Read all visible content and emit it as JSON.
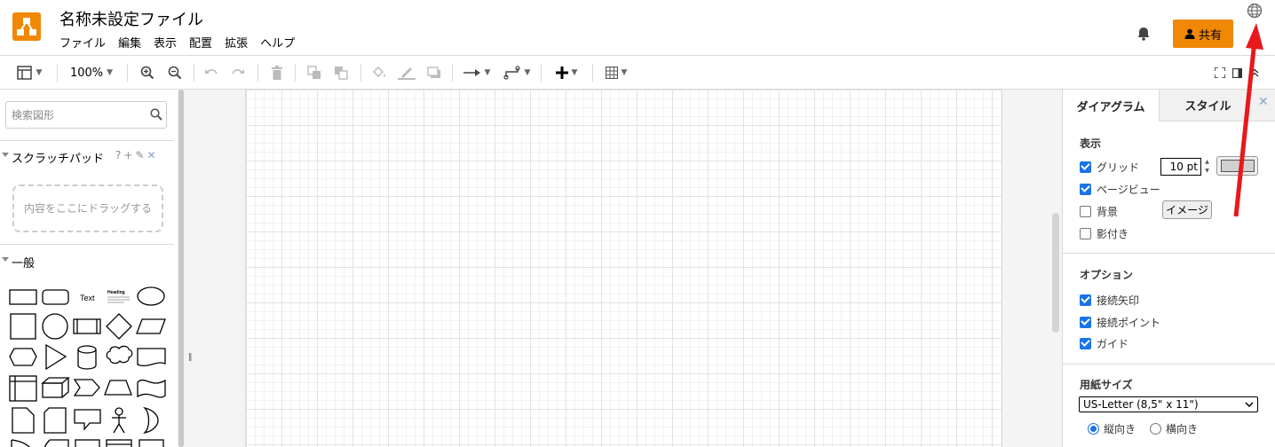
{
  "app": {
    "title": "名称未設定ファイル",
    "menu": [
      "ファイル",
      "編集",
      "表示",
      "配置",
      "拡張",
      "ヘルプ"
    ],
    "share_label": "共有",
    "brand_color": "#f08705"
  },
  "toolbar": {
    "zoom": "100%"
  },
  "sidebar": {
    "search_placeholder": "検索図形",
    "scratchpad_title": "スクラッチパッド",
    "scratchpad_tools": [
      "?",
      "+",
      "✎",
      "✕"
    ],
    "dropzone_text": "内容をここにドラッグする",
    "general_title": "一般",
    "shape_text": "Text",
    "shape_heading": "Heading"
  },
  "panel": {
    "tab_diagram": "ダイアグラム",
    "tab_style": "スタイル",
    "view_title": "表示",
    "grid_label": "グリッド",
    "grid_checked": true,
    "grid_size": "10 pt",
    "pageview_label": "ページビュー",
    "pageview_checked": true,
    "background_label": "背景",
    "background_checked": false,
    "image_button": "イメージ",
    "shadow_label": "影付き",
    "shadow_checked": false,
    "options_title": "オプション",
    "connection_arrows_label": "接続矢印",
    "connection_points_label": "接続ポイント",
    "guides_label": "ガイド",
    "paper_title": "用紙サイズ",
    "paper_size": "US-Letter (8,5\" x 11\")",
    "portrait_label": "縦向き",
    "landscape_label": "横向き"
  }
}
